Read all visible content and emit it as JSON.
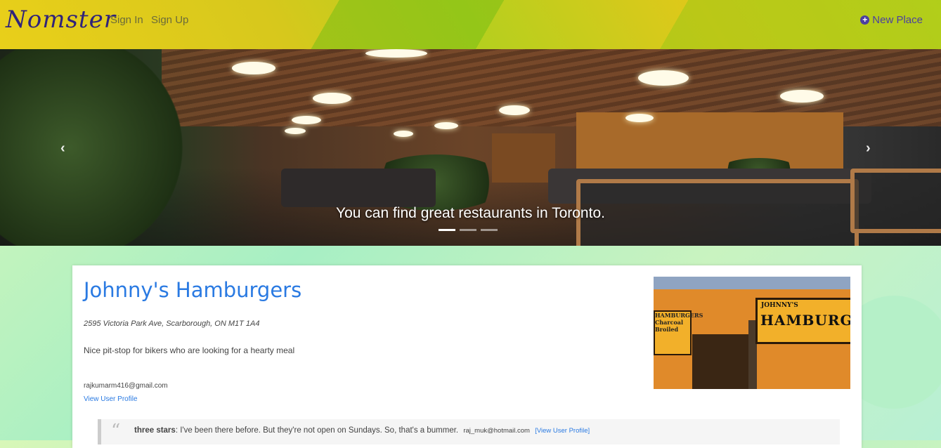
{
  "navbar": {
    "brand": "Nomster",
    "sign_in": "Sign In",
    "sign_up": "Sign Up",
    "new_place": "New Place",
    "new_place_icon": "plus-circle-icon"
  },
  "carousel": {
    "caption": "You can find great restaurants in Toronto.",
    "prev_icon": "chevron-left-icon",
    "next_icon": "chevron-right-icon",
    "slides": 3,
    "active_slide": 1
  },
  "place": {
    "name": "Johnny's Hamburgers",
    "address": "2595 Victoria Park Ave, Scarborough, ON M1T 1A4",
    "description": "Nice pit-stop for bikers who are looking for a hearty meal",
    "owner_email": "rajkumarm416@gmail.com",
    "view_profile": "View User Profile",
    "photo": {
      "sign_small": "JOHNNY'S",
      "sign_big": "HAMBURGERS",
      "side_sign": "HAMBURGERS Charcoal Broiled"
    }
  },
  "review": {
    "rating": "three stars",
    "text": ": I've been there before. But they're not open on Sundays. So, that's a bummer.",
    "email": "raj_muk@hotmail.com",
    "link_open": "[",
    "link": "View User Profile",
    "link_close": "]"
  },
  "colors": {
    "brand": "#30237a",
    "link": "#2a7ae2",
    "navbar": "#d7c81c"
  }
}
